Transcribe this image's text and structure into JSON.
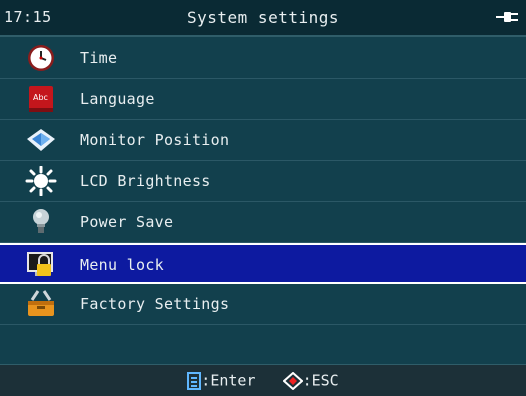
{
  "header": {
    "time": "17:15",
    "title": "System settings",
    "power_icon": "plug-icon"
  },
  "menu": {
    "items": [
      {
        "label": "Time",
        "icon": "clock-icon"
      },
      {
        "label": "Language",
        "icon": "book-icon"
      },
      {
        "label": "Monitor Position",
        "icon": "monitor-position-icon"
      },
      {
        "label": "LCD Brightness",
        "icon": "sun-icon"
      },
      {
        "label": "Power Save",
        "icon": "bulb-icon"
      },
      {
        "label": "Menu lock",
        "icon": "lock-monitor-icon",
        "selected": true
      },
      {
        "label": "Factory Settings",
        "icon": "toolbox-icon"
      }
    ]
  },
  "footer": {
    "enter_icon": "enter-icon",
    "enter_label": ":Enter",
    "esc_icon": "esc-icon",
    "esc_label": ":ESC"
  },
  "colors": {
    "background": "#12404d",
    "header": "#0a2a34",
    "selected": "#0d1aa0",
    "footer": "#1c3038",
    "text": "#e8eef0"
  }
}
